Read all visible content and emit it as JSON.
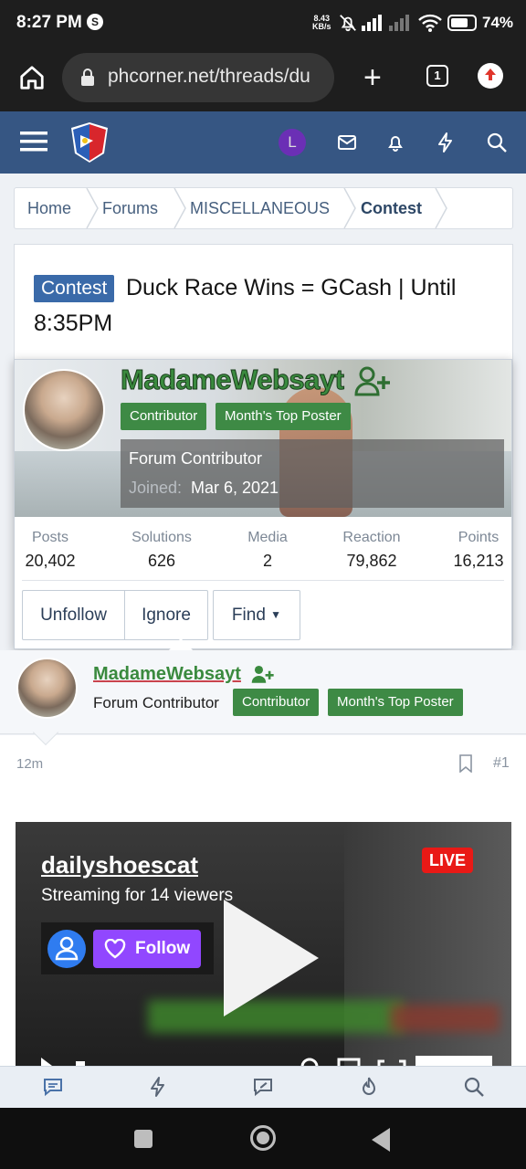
{
  "status_bar": {
    "time": "8:27 PM",
    "app_icon_letter": "S",
    "net_speed_value": "8.43",
    "net_speed_unit": "KB/s",
    "battery": "74%",
    "battery_level": 0.74
  },
  "browser": {
    "url": "phcorner.net/threads/du",
    "tab_count": "1"
  },
  "site_header": {
    "avatar_letter": "L"
  },
  "breadcrumb": {
    "items": [
      "Home",
      "Forums",
      "MISCELLANEOUS",
      "Contest"
    ]
  },
  "thread": {
    "prefix": "Contest",
    "title_line1": "Duck Race Wins = GCash | Until",
    "title_line2": "8:35PM"
  },
  "member_tooltip": {
    "name": "MadameWebsayt",
    "badges": [
      "Contributor",
      "Month's Top Poster"
    ],
    "user_title": "Forum Contributor",
    "joined_label": "Joined:",
    "joined_value": "Mar 6, 2021",
    "stats": [
      {
        "label": "Posts",
        "value": "20,402"
      },
      {
        "label": "Solutions",
        "value": "626"
      },
      {
        "label": "Media",
        "value": "2"
      },
      {
        "label": "Reaction",
        "value": "79,862"
      },
      {
        "label": "Points",
        "value": "16,213"
      }
    ],
    "buttons": {
      "unfollow": "Unfollow",
      "ignore": "Ignore",
      "find": "Find"
    }
  },
  "post": {
    "author": "MadameWebsayt",
    "user_title": "Forum Contributor",
    "badges": [
      "Contributor",
      "Month's Top Poster"
    ],
    "time": "12m",
    "number": "#1"
  },
  "stream": {
    "channel": "dailyshoescat",
    "live_label": "LIVE",
    "viewers_text": "Streaming for 14 viewers",
    "follow_label": "Follow",
    "colors": {
      "live": "#e91916",
      "follow": "#9147ff"
    }
  },
  "colors": {
    "site_header": "#365683",
    "badge_green": "#3e8a45",
    "prefix_blue": "#3a6aa9"
  }
}
